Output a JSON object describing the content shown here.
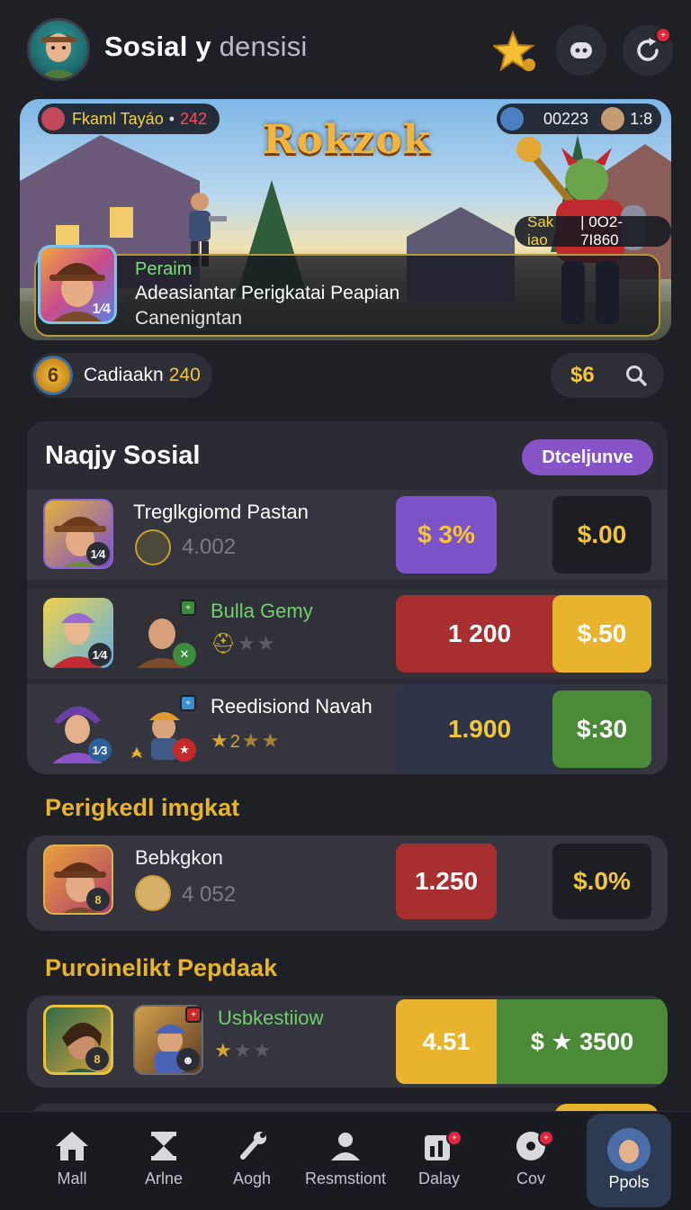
{
  "header": {
    "title_part1": "Sosial y",
    "title_part2": "densisi",
    "refresh_badge": "+"
  },
  "banner": {
    "game_logo": "Rokzok",
    "player_pill": {
      "name": "Fkaml Tayáo",
      "separator": "•",
      "value": "242"
    },
    "score_pill": {
      "value": "00223",
      "value2": "1:8"
    },
    "timer_pill": {
      "label": "Sak iao",
      "value": "| 0O2-7I860"
    },
    "event": {
      "tag": "Peraim",
      "title": "Adeasiantar Perigkatai Peapian",
      "subtitle": "Canenigntan",
      "avatar_level": "1⁄4"
    }
  },
  "currency": {
    "coin_glyph": "6",
    "label": "Cadiaakn",
    "amount": "240",
    "money": "$6"
  },
  "section1": {
    "title": "Naqjy Sosial",
    "action_button": "Dtceljunve",
    "rows": [
      {
        "name": "Treglkgiomd Pastan",
        "sub": "4.002",
        "level": "1⁄4",
        "box1": "$ 3%",
        "box2": "$.00"
      },
      {
        "name": "Bulla Gemy",
        "level1": "1⁄4",
        "tag": "+",
        "box1": "1 200",
        "box2": "$.50"
      },
      {
        "name": "Reedisiond Navah",
        "level1": "1⁄3",
        "tag": "+",
        "stars": "2",
        "box1": "1.900",
        "box2": "$:30"
      }
    ]
  },
  "section2": {
    "title": "Perigkedl imgkat",
    "row": {
      "name": "Bebkgkon",
      "sub": "4 052",
      "level": "8",
      "box1": "1.250",
      "box2": "$.0%"
    }
  },
  "section3": {
    "title": "Puroinelikt Pepdaak",
    "row": {
      "name": "Usbkestiiow",
      "level": "8",
      "tag": "+",
      "box1": "4.51",
      "box2": "$ ★ 3500"
    }
  },
  "nav": {
    "items": [
      {
        "label": "Mall",
        "icon": "home-icon"
      },
      {
        "label": "Arlne",
        "icon": "hourglass-icon"
      },
      {
        "label": "Aogh",
        "icon": "wrench-icon"
      },
      {
        "label": "Resmstiont",
        "icon": "person-icon"
      },
      {
        "label": "Dalay",
        "icon": "chart-icon",
        "badge": "+"
      },
      {
        "label": "Cov",
        "icon": "disc-icon",
        "badge": "+"
      },
      {
        "label": "Ppols",
        "icon": "profile-avatar"
      }
    ]
  },
  "colors": {
    "background": "#1f2026",
    "accent_gold": "#f4c63c",
    "accent_purple": "#8654c6",
    "accent_red": "#a72f2f",
    "accent_green": "#4b8a37"
  }
}
